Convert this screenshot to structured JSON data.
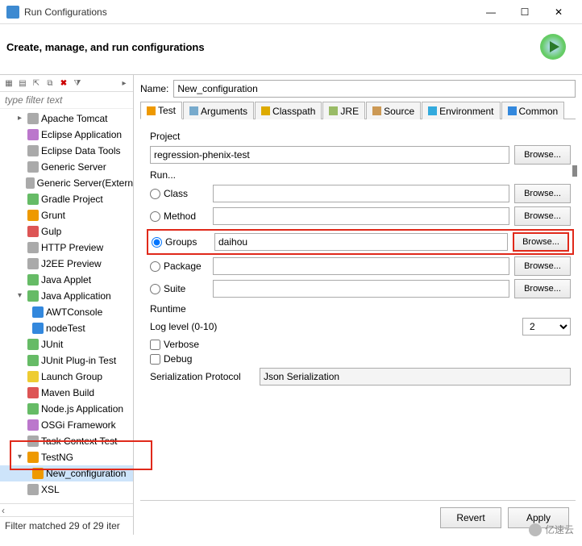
{
  "window": {
    "title": "Run Configurations"
  },
  "header": {
    "heading": "Create, manage, and run configurations"
  },
  "sidebar": {
    "filter_placeholder": "type filter text",
    "items": [
      {
        "label": "Apache Tomcat",
        "icon": "gray",
        "indent": 1,
        "arrow": "▸"
      },
      {
        "label": "Eclipse Application",
        "icon": "purple",
        "indent": 1
      },
      {
        "label": "Eclipse Data Tools",
        "icon": "gray",
        "indent": 1
      },
      {
        "label": "Generic Server",
        "icon": "gray",
        "indent": 1
      },
      {
        "label": "Generic Server(Extern",
        "icon": "gray",
        "indent": 1
      },
      {
        "label": "Gradle Project",
        "icon": "green",
        "indent": 1
      },
      {
        "label": "Grunt",
        "icon": "orange",
        "indent": 1
      },
      {
        "label": "Gulp",
        "icon": "red",
        "indent": 1
      },
      {
        "label": "HTTP Preview",
        "icon": "gray",
        "indent": 1
      },
      {
        "label": "J2EE Preview",
        "icon": "gray",
        "indent": 1
      },
      {
        "label": "Java Applet",
        "icon": "green",
        "indent": 1
      },
      {
        "label": "Java Application",
        "icon": "green",
        "indent": 1,
        "arrow": "▾"
      },
      {
        "label": "AWTConsole",
        "icon": "blue",
        "indent": 2
      },
      {
        "label": "nodeTest",
        "icon": "blue",
        "indent": 2
      },
      {
        "label": "JUnit",
        "icon": "green",
        "indent": 1
      },
      {
        "label": "JUnit Plug-in Test",
        "icon": "green",
        "indent": 1
      },
      {
        "label": "Launch Group",
        "icon": "yellow",
        "indent": 1
      },
      {
        "label": "Maven Build",
        "icon": "red",
        "indent": 1
      },
      {
        "label": "Node.js Application",
        "icon": "green",
        "indent": 1
      },
      {
        "label": "OSGi Framework",
        "icon": "purple",
        "indent": 1
      },
      {
        "label": "Task Context Test",
        "icon": "gray",
        "indent": 1
      },
      {
        "label": "TestNG",
        "icon": "orange",
        "indent": 1,
        "arrow": "▾"
      },
      {
        "label": "New_configuration",
        "icon": "orange",
        "indent": 2,
        "sel": true
      },
      {
        "label": "XSL",
        "icon": "gray",
        "indent": 1
      }
    ],
    "status": "Filter matched 29 of 29 iter"
  },
  "details": {
    "name_label": "Name:",
    "name_value": "New_configuration",
    "tabs": {
      "test": "Test",
      "arguments": "Arguments",
      "classpath": "Classpath",
      "jre": "JRE",
      "source": "Source",
      "environment": "Environment",
      "common": "Common"
    },
    "project": {
      "label": "Project",
      "value": "regression-phenix-test",
      "browse": "Browse..."
    },
    "run": {
      "label": "Run...",
      "class": "Class",
      "method": "Method",
      "groups": "Groups",
      "package": "Package",
      "suite": "Suite",
      "groups_value": "daihou",
      "browse": "Browse..."
    },
    "runtime": {
      "label": "Runtime",
      "log_level_label": "Log level (0-10)",
      "log_level_value": "2",
      "verbose": "Verbose",
      "debug": "Debug",
      "sp_label": "Serialization Protocol",
      "sp_value": "Json Serialization"
    }
  },
  "footer": {
    "revert": "Revert",
    "apply": "Apply"
  },
  "watermark": "亿速云"
}
